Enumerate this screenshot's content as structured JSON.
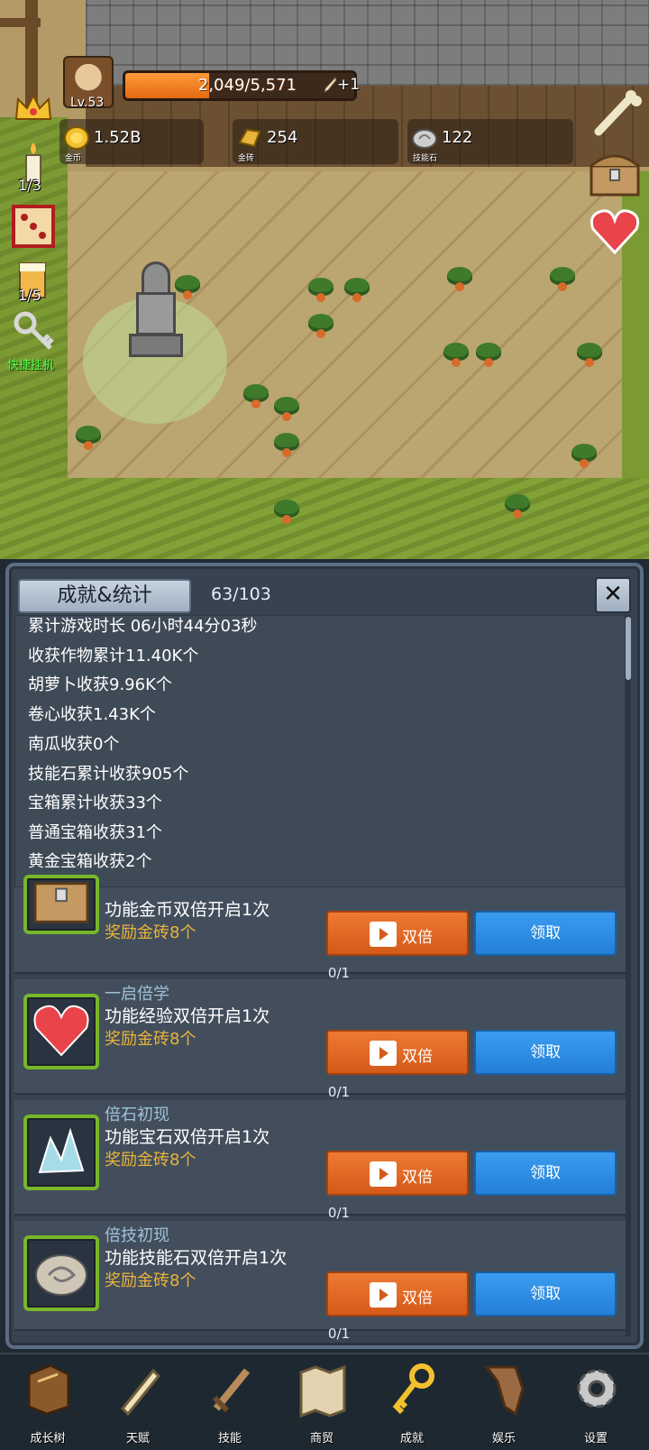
{
  "hud": {
    "level": "Lv.53",
    "xp_text": "2,049/5,571",
    "xp_fraction": 0.368,
    "xp_bonus": "+1",
    "resources": [
      {
        "icon": "gold-coin-icon",
        "value": "1.52B",
        "caption": "金币"
      },
      {
        "icon": "gold-brick-icon",
        "value": "254",
        "caption": "金砖"
      },
      {
        "icon": "skill-stone-icon",
        "value": "122",
        "caption": "技能石"
      }
    ],
    "side": {
      "candle_count": "1/3",
      "drink_count": "1/5",
      "quick_label": "快捷挂机"
    }
  },
  "panel": {
    "tab_label": "成就&统计",
    "count": "63/103",
    "close_label": "✕",
    "stats": [
      "累计游戏时长 06小时44分03秒",
      "收获作物累计11.40K个",
      "胡萝卜收获9.96K个",
      "卷心收获1.43K个",
      "南瓜收获0个",
      "技能石累计收获905个",
      "宝箱累计收获33个",
      "普通宝箱收获31个",
      "黄金宝箱收获2个"
    ],
    "cards": [
      {
        "icon": "treasure-chest-icon",
        "title": "",
        "desc": "功能金币双倍开启1次",
        "reward": "奖励金砖8个",
        "double": "双倍",
        "claim": "领取",
        "progress": "0/1"
      },
      {
        "icon": "heart-icon",
        "title": "一启倍学",
        "desc": "功能经验双倍开启1次",
        "reward": "奖励金砖8个",
        "double": "双倍",
        "claim": "领取",
        "progress": "0/1"
      },
      {
        "icon": "crystal-icon",
        "title": "倍石初现",
        "desc": "功能宝石双倍开启1次",
        "reward": "奖励金砖8个",
        "double": "双倍",
        "claim": "领取",
        "progress": "0/1"
      },
      {
        "icon": "skill-stone-icon",
        "title": "倍技初现",
        "desc": "功能技能石双倍开启1次",
        "reward": "奖励金砖8个",
        "double": "双倍",
        "claim": "领取",
        "progress": "0/1"
      }
    ]
  },
  "nav": [
    {
      "icon": "book-icon",
      "label": "成长树"
    },
    {
      "icon": "scroll-icon",
      "label": "天赋"
    },
    {
      "icon": "sword-icon",
      "label": "技能"
    },
    {
      "icon": "map-icon",
      "label": "商贸"
    },
    {
      "icon": "key-icon",
      "label": "成就"
    },
    {
      "icon": "ribbon-icon",
      "label": "娱乐"
    },
    {
      "icon": "gear-icon",
      "label": "设置"
    }
  ]
}
